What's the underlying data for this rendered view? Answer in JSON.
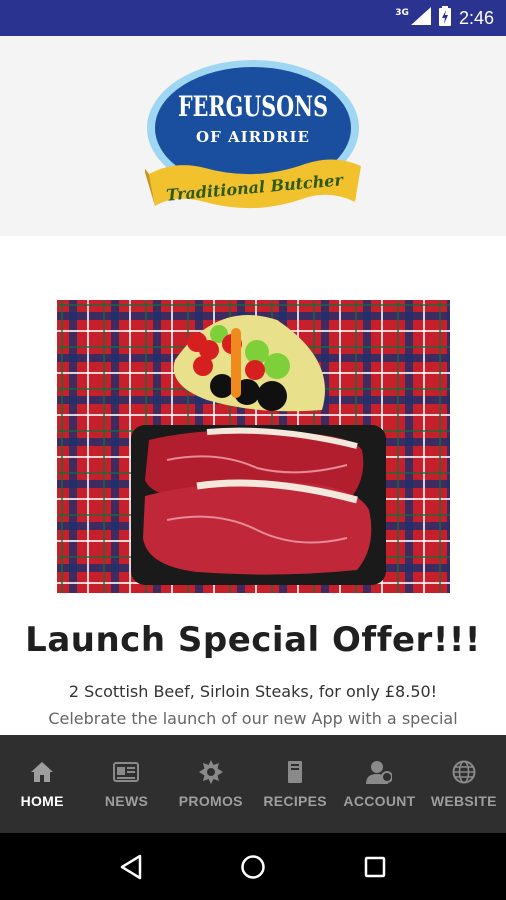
{
  "status_bar": {
    "network": "3G",
    "time": "2:46"
  },
  "logo": {
    "line1": "FERGUSONS",
    "line2": "OF AIRDRIE",
    "banner": "Traditional Butcher"
  },
  "offer": {
    "title": "Launch Special Offer!!!",
    "subtitle": "2 Scottish Beef, Sirloin Steaks, for only £8.50!",
    "description": "Celebrate the launch of our new App with a special"
  },
  "tabs": [
    {
      "label": "HOME",
      "icon": "home-icon",
      "active": true
    },
    {
      "label": "NEWS",
      "icon": "news-icon",
      "active": false
    },
    {
      "label": "PROMOS",
      "icon": "promos-icon",
      "active": false
    },
    {
      "label": "RECIPES",
      "icon": "recipes-icon",
      "active": false
    },
    {
      "label": "ACCOUNT",
      "icon": "account-icon",
      "active": false
    },
    {
      "label": "WEBSITE",
      "icon": "website-icon",
      "active": false
    }
  ],
  "colors": {
    "status_bar": "#2a3390",
    "tab_bar": "#2f2f2f",
    "tab_active": "#ffffff",
    "tab_inactive": "#9e9e9e",
    "logo_blue": "#1a4fa0",
    "logo_gold": "#f2c12e"
  }
}
